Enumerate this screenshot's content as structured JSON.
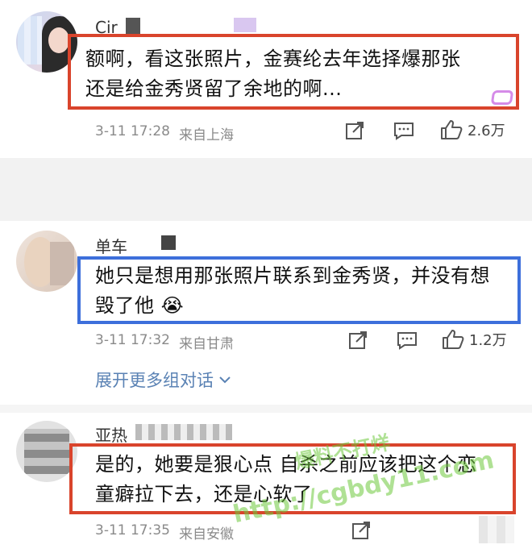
{
  "colors": {
    "red_box": "#d9442c",
    "blue_box": "#3d6fdb",
    "link": "#5a82b4",
    "meta": "#8a8a8a"
  },
  "comments": [
    {
      "author": "Cir",
      "text_line1": "额啊，看这张照片，金赛纶去年选择爆那张",
      "text_line2": "还是给金秀贤留了余地的啊...",
      "time": "3-11 17:28",
      "location": "来自上海",
      "likes": "2.6万"
    },
    {
      "author": "单车",
      "text_line1": "她只是想用那张照片联系到金秀贤，并没有想",
      "text_line2": "毁了他",
      "emoji": "😭",
      "time": "3-11 17:32",
      "location": "来自甘肃",
      "likes": "1.2万"
    },
    {
      "author": "亚热",
      "text_line1": "是的，她要是狠心点 自杀之前应该把这个恋",
      "text_line2": "童癖拉下去，还是心软了",
      "time": "3-11 17:35",
      "location": "来自安徽"
    }
  ],
  "expand_label": "展开更多组对话",
  "icons": [
    "share-icon",
    "comment-icon",
    "like-icon",
    "chevron-down-icon"
  ],
  "watermark": {
    "line1": "爆料不打烊",
    "line2": "http://cgbdy11.com"
  }
}
